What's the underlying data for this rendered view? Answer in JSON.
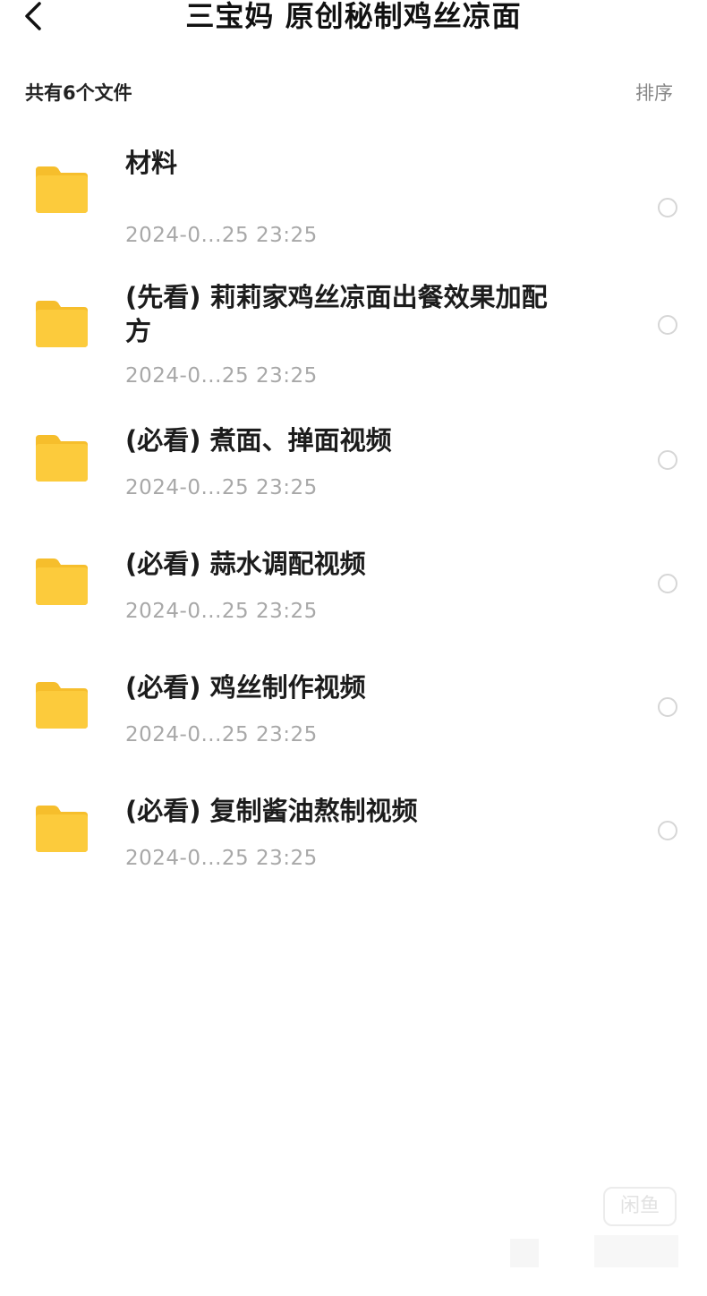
{
  "header": {
    "title": "三宝妈 原创秘制鸡丝凉面",
    "back_icon": "chevron-left-icon"
  },
  "summary": {
    "count_text": "共有6个文件",
    "sort_label": "排序"
  },
  "colors": {
    "folder": "#FCCB3C",
    "folder_tab": "#F6BE2C",
    "date_text": "#A8A8A8",
    "radio_border": "#D6D6D6"
  },
  "files": [
    {
      "name": "材料",
      "date": "2024-0...25 23:25",
      "icon": "folder-icon"
    },
    {
      "name": "(先看) 莉莉家鸡丝凉面出餐效果加配方",
      "date": "2024-0...25 23:25",
      "icon": "folder-icon"
    },
    {
      "name": "(必看) 煮面、掸面视频",
      "date": "2024-0...25 23:25",
      "icon": "folder-icon"
    },
    {
      "name": "(必看) 蒜水调配视频",
      "date": "2024-0...25 23:25",
      "icon": "folder-icon"
    },
    {
      "name": "(必看) 鸡丝制作视频",
      "date": "2024-0...25 23:25",
      "icon": "folder-icon"
    },
    {
      "name": "(必看) 复制酱油熬制视频",
      "date": "2024-0...25 23:25",
      "icon": "folder-icon"
    }
  ],
  "watermark": {
    "text": "闲鱼"
  }
}
